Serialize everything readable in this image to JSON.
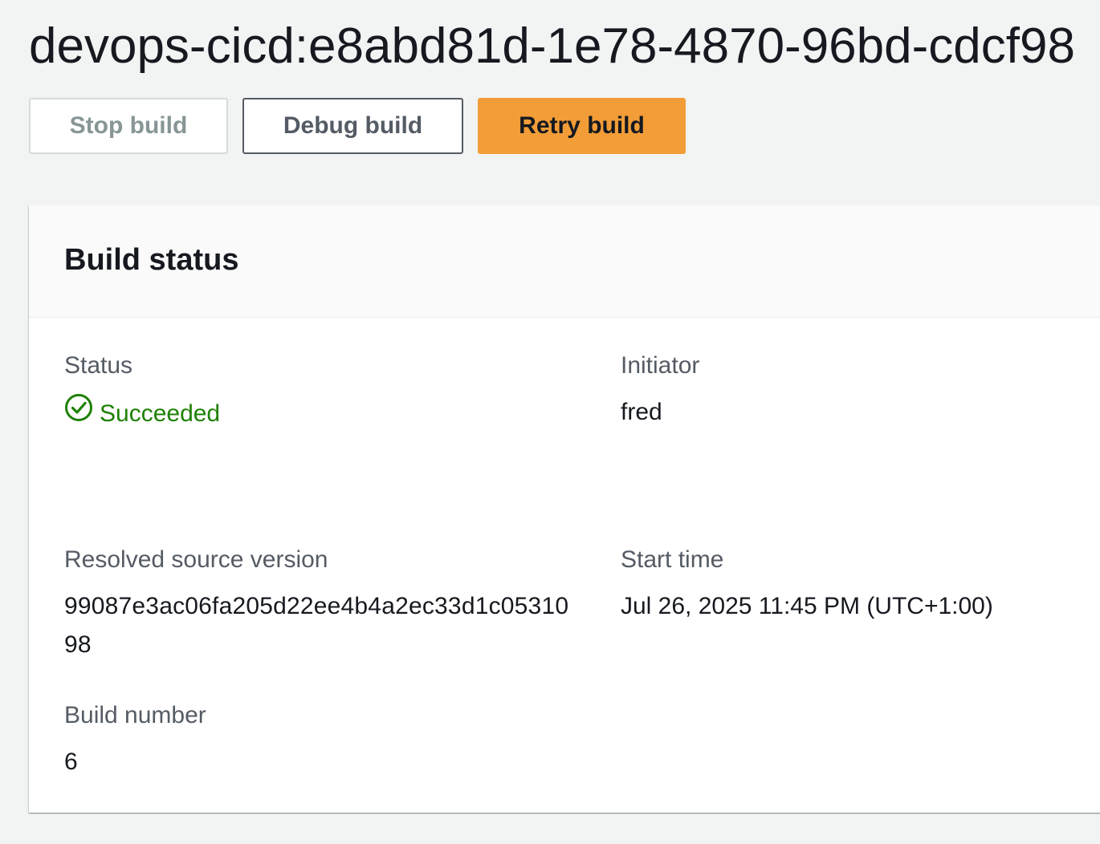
{
  "header": {
    "title": "devops-cicd:e8abd81d-1e78-4870-96bd-cdcf98"
  },
  "actions": {
    "stop_label": "Stop build",
    "debug_label": "Debug build",
    "retry_label": "Retry build"
  },
  "build_status": {
    "title": "Build status",
    "fields": {
      "status_label": "Status",
      "status_value": "Succeeded",
      "initiator_label": "Initiator",
      "initiator_value": "fred",
      "source_version_label": "Resolved source version",
      "source_version_value": "99087e3ac06fa205d22ee4b4a2ec33d1c0531098",
      "start_time_label": "Start time",
      "start_time_value": "Jul 26, 2025 11:45 PM (UTC+1:00)",
      "build_number_label": "Build number",
      "build_number_value": "6"
    }
  },
  "colors": {
    "success": "#1d8102",
    "primary_button": "#f29d38",
    "background": "#f2f3f3"
  },
  "icons": {
    "status": "check-circle-icon"
  }
}
